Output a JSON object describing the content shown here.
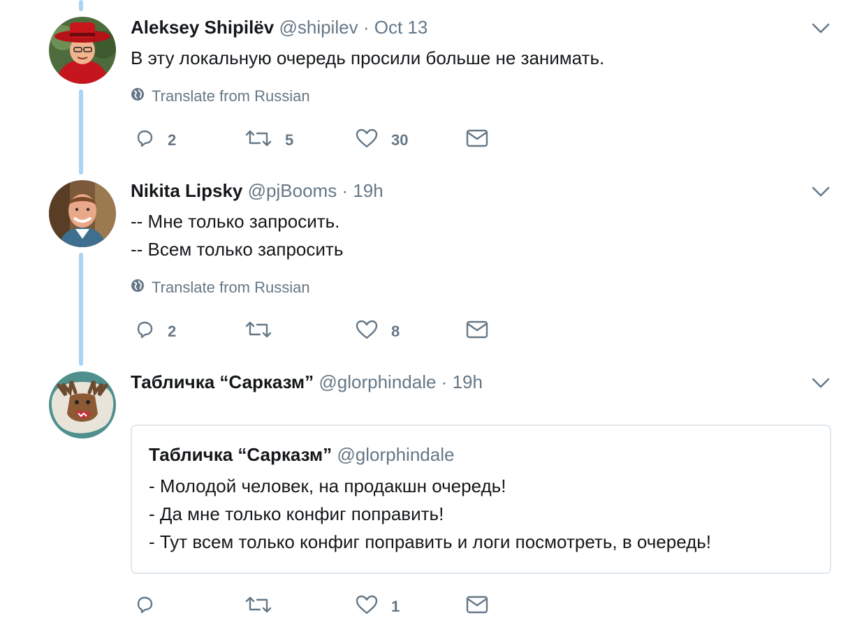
{
  "tweets": [
    {
      "name": "Aleksey Shipilёv",
      "handle": "@shipilev",
      "separator": "·",
      "time": "Oct 13",
      "lines": [
        "В эту локальную очередь просили больше не занимать."
      ],
      "translate": "Translate from Russian",
      "counts": {
        "replies": "2",
        "retweets": "5",
        "likes": "30"
      }
    },
    {
      "name": "Nikita Lipsky",
      "handle": "@pjBooms",
      "separator": "·",
      "time": "19h",
      "lines": [
        "-- Мне только запросить.",
        "-- Всем только запросить"
      ],
      "translate": "Translate from Russian",
      "counts": {
        "replies": "2",
        "retweets": "",
        "likes": "8"
      }
    },
    {
      "name": "Табличка “Сарказм”",
      "handle": "@glorphindale",
      "separator": "·",
      "time": "19h",
      "quote": {
        "name": "Табличка “Сарказм”",
        "handle": "@glorphindale",
        "lines": [
          "- Молодой человек, на продакшн очередь!",
          "- Да мне только конфиг поправить!",
          "- Тут всем только конфиг поправить и логи посмотреть, в очередь!"
        ]
      },
      "counts": {
        "replies": "",
        "retweets": "",
        "likes": "1"
      }
    }
  ],
  "icons": [
    "reply-icon",
    "retweet-icon",
    "like-icon",
    "direct-message-icon",
    "globe-icon",
    "chevron-down-icon"
  ],
  "colors": {
    "thread_line": "#a9d4f5",
    "muted": "#657786",
    "text": "#14171a",
    "border": "#e1e8ed"
  }
}
